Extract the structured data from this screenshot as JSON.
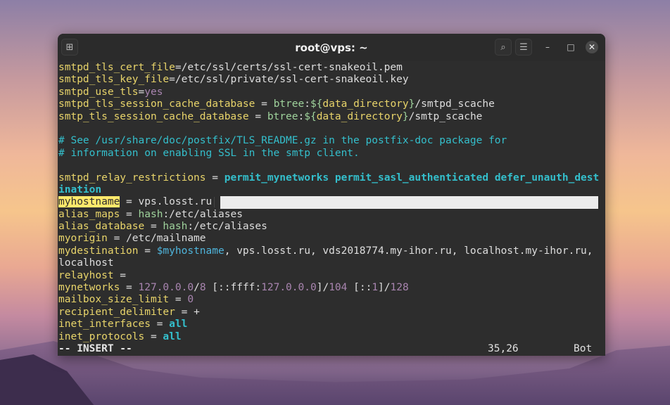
{
  "window": {
    "title": "root@vps: ~",
    "new_tab_icon": "new-tab-icon",
    "search_icon": "search-icon",
    "menu_icon": "hamburger-menu-icon",
    "minimize_icon": "minimize-icon",
    "maximize_icon": "maximize-icon",
    "close_icon": "close-icon"
  },
  "editor": {
    "lines": [
      [
        [
          "smtpd_tls_cert_file",
          "k"
        ],
        [
          "=/etc/ssl/certs/ssl-cert-snakeoil.pem",
          "w"
        ]
      ],
      [
        [
          "smtpd_tls_key_file",
          "k"
        ],
        [
          "=/etc/ssl/private/ssl-cert-snakeoil.key",
          "w"
        ]
      ],
      [
        [
          "smtpd_use_tls",
          "k"
        ],
        [
          "=",
          "w"
        ],
        [
          "yes",
          "p"
        ]
      ],
      [
        [
          "smtpd_tls_session_cache_database",
          "k"
        ],
        [
          " = ",
          "w"
        ],
        [
          "btree",
          "g"
        ],
        [
          ":",
          "w"
        ],
        [
          "${",
          "g"
        ],
        [
          "data_directory",
          "k"
        ],
        [
          "}",
          "g"
        ],
        [
          "/smtpd_scache",
          "w"
        ]
      ],
      [
        [
          "smtp_tls_session_cache_database",
          "k"
        ],
        [
          " = ",
          "w"
        ],
        [
          "btree",
          "g"
        ],
        [
          ":",
          "w"
        ],
        [
          "${",
          "g"
        ],
        [
          "data_directory",
          "k"
        ],
        [
          "}",
          "g"
        ],
        [
          "/smtp_scache",
          "w"
        ]
      ],
      [],
      [
        [
          "# See /usr/share/doc/postfix/TLS_README.gz in the postfix-doc package for",
          "c"
        ]
      ],
      [
        [
          "# information on enabling SSL in the smtp client.",
          "c"
        ]
      ],
      [],
      [
        [
          "smtpd_relay_restrictions",
          "k"
        ],
        [
          " = ",
          "w"
        ],
        [
          "permit_mynetworks permit_sasl_authenticated defer_unauth_dest",
          "cb"
        ]
      ],
      [
        [
          "ination",
          "cb"
        ]
      ],
      [
        [
          "myhostname",
          "hl"
        ],
        [
          " = vps.losst.ru",
          "w"
        ]
      ],
      [
        [
          "alias_maps",
          "k"
        ],
        [
          " = ",
          "w"
        ],
        [
          "hash",
          "g"
        ],
        [
          ":/etc/aliases",
          "w"
        ]
      ],
      [
        [
          "alias_database",
          "k"
        ],
        [
          " = ",
          "w"
        ],
        [
          "hash",
          "g"
        ],
        [
          ":/etc/aliases",
          "w"
        ]
      ],
      [
        [
          "myorigin",
          "k"
        ],
        [
          " = /etc/mailname",
          "w"
        ]
      ],
      [
        [
          "mydestination",
          "k"
        ],
        [
          " = ",
          "w"
        ],
        [
          "$myhostname",
          "v"
        ],
        [
          ", vps.losst.ru, vds2018774.my-ihor.ru, localhost.my-ihor.ru,",
          "w"
        ]
      ],
      [
        [
          "localhost",
          "w"
        ]
      ],
      [
        [
          "relayhost",
          "k"
        ],
        [
          " =",
          "w"
        ]
      ],
      [
        [
          "mynetworks",
          "k"
        ],
        [
          " = ",
          "w"
        ],
        [
          "127.0.0.0",
          "p"
        ],
        [
          "/",
          "w"
        ],
        [
          "8",
          "p"
        ],
        [
          " [::ffff:",
          "w"
        ],
        [
          "127.0.0.0",
          "p"
        ],
        [
          "]/",
          "w"
        ],
        [
          "104",
          "p"
        ],
        [
          " [::",
          "w"
        ],
        [
          "1",
          "p"
        ],
        [
          "]/",
          "w"
        ],
        [
          "128",
          "p"
        ]
      ],
      [
        [
          "mailbox_size_limit",
          "k"
        ],
        [
          " = ",
          "w"
        ],
        [
          "0",
          "p"
        ]
      ],
      [
        [
          "recipient_delimiter",
          "k"
        ],
        [
          " = +",
          "w"
        ]
      ],
      [
        [
          "inet_interfaces",
          "k"
        ],
        [
          " = ",
          "w"
        ],
        [
          "all",
          "cb"
        ]
      ],
      [
        [
          "inet_protocols",
          "k"
        ],
        [
          " = ",
          "w"
        ],
        [
          "all",
          "cb"
        ]
      ]
    ],
    "mode": "-- INSERT --",
    "position": "35,26",
    "scroll": "Bot"
  }
}
